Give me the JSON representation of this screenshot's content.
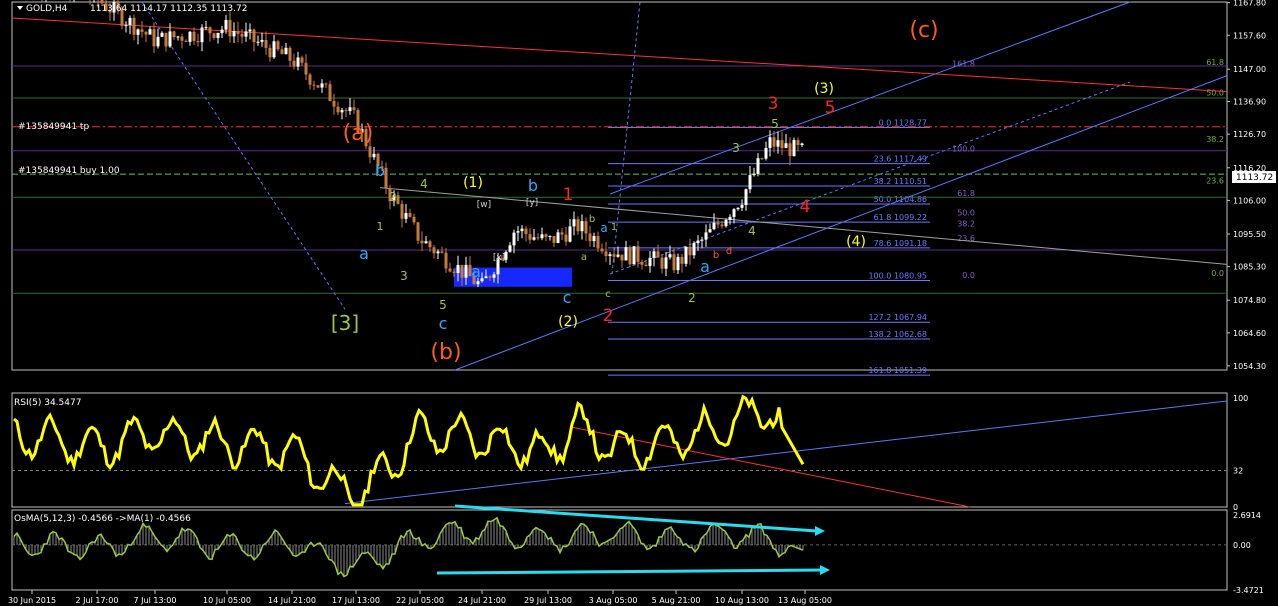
{
  "colors": {
    "background": "#000000",
    "frame": "#c0c0c0",
    "candle_up": "#ffffff",
    "candle_down": "#c87a3a",
    "rsi_line": "#ffff00",
    "osma_line": "#9ac840",
    "osma_hist": "#8a8a8a",
    "fib_blue": "#6a78ff",
    "channel": "#5a78ff",
    "trend_red": "#ff3030",
    "arrow_cyan": "#28dcf0",
    "zone_blue": "#1428ff",
    "hline_green": "#2e6a2e",
    "hline_purple": "#5a2a8a",
    "label_red": "#ff2020",
    "label_orange": "#ff5a1a",
    "label_yellow": "#ffff20",
    "label_green": "#9ac840",
    "label_cyan": "#30a8ff"
  },
  "header": {
    "title": "GOLD,H4",
    "ohlc": "1113.64 1114.17 1112.35 1113.72"
  },
  "order_lines": {
    "tp_label": "#135849941 tp",
    "buy_label": "#135849941 buy 1.00",
    "current_price": "1113.72"
  },
  "chart_data": [
    {
      "type": "line",
      "panel": "price",
      "symbol": "GOLD",
      "timeframe": "H4",
      "title": "GOLD,H4 1113.64 1114.17 1112.35 1113.72",
      "ylim": [
        1053,
        1168
      ],
      "price_axis": [
        "1167.80",
        "1157.60",
        "1147.00",
        "1136.90",
        "1126.70",
        "1116.20",
        "1106.00",
        "1095.50",
        "1085.30",
        "1074.80",
        "1064.60",
        "1054.30"
      ],
      "x_labels": [
        "30 Jun 2015",
        "2 Jul 17:00",
        "7 Jul 13:00",
        "10 Jul 05:00",
        "14 Jul 21:00",
        "17 Jul 13:00",
        "22 Jul 05:00",
        "24 Jul 21:00",
        "29 Jul 13:00",
        "3 Aug 05:00",
        "5 Aug 21:00",
        "10 Aug 13:00",
        "13 Aug 05:00"
      ],
      "series": [
        {
          "name": "GOLD",
          "x": [
            "30 Jun 2015",
            "2 Jul 17:00",
            "7 Jul 13:00",
            "10 Jul 05:00",
            "14 Jul 21:00",
            "17 Jul 13:00",
            "20 Jul 05:00",
            "22 Jul 05:00",
            "24 Jul 21:00",
            "27 Jul 21:00",
            "29 Jul 13:00",
            "31 Jul 09:00",
            "3 Aug 05:00",
            "5 Aug 21:00",
            "7 Aug 13:00",
            "10 Aug 13:00",
            "11 Aug 21:00",
            "13 Aug 05:00",
            "14 Aug 05:00"
          ],
          "values": [
            1174.5,
            1169.0,
            1156.0,
            1160.0,
            1150.0,
            1131.0,
            1108.0,
            1094.0,
            1079.0,
            1097.0,
            1093.0,
            1098.0,
            1090.0,
            1086.0,
            1094.5,
            1107.0,
            1124.0,
            1121.0,
            1113.7
          ]
        }
      ],
      "fibonacci": {
        "retracement": [
          {
            "label": "0.0 1128.77",
            "value": 1128.77
          },
          {
            "label": "23.6 1117.49",
            "value": 1117.49
          },
          {
            "label": "38.2 1110.51",
            "value": 1110.51
          },
          {
            "label": "50.0 1104.86",
            "value": 1104.86
          },
          {
            "label": "61.8 1099.22",
            "value": 1099.22
          },
          {
            "label": "78.6 1091.18",
            "value": 1091.18
          },
          {
            "label": "100.0 1080.95",
            "value": 1080.95
          },
          {
            "label": "127.2 1067.94",
            "value": 1067.94
          },
          {
            "label": "138.2 1062.68",
            "value": 1062.68
          },
          {
            "label": "161.8 1051.39",
            "value": 1051.39
          }
        ],
        "purple_levels": [
          "161.8",
          "100.0",
          "61.8",
          "50.0",
          "38.2",
          "23.6",
          "0.0"
        ],
        "green_levels": [
          "61.8",
          "50.0",
          "38.2",
          "23.6",
          "0.0"
        ]
      },
      "wave_labels": {
        "red": [
          "3",
          "5",
          "1",
          "4",
          "2"
        ],
        "orange": [
          "(c)",
          "(a)",
          "(b)"
        ],
        "yellow": [
          "(3)",
          "(1)",
          "(4)",
          "(2)"
        ],
        "green": [
          "[3]",
          "4",
          "2",
          "3",
          "5",
          "1",
          "3",
          "4",
          "5",
          "2",
          "a",
          "b",
          "c",
          "1"
        ],
        "cyan": [
          "b",
          "a",
          "b",
          "c",
          "c",
          "a",
          "a",
          "a"
        ],
        "white": [
          "[w]",
          "[y]",
          "[x]"
        ]
      }
    },
    {
      "type": "line",
      "panel": "rsi",
      "title": "RSI(5) 34.5477",
      "ylim": [
        0,
        100
      ],
      "levels": [
        "100",
        "32",
        "0"
      ],
      "series": [
        {
          "name": "RSI(5)",
          "x": [
            "30 Jun 2015",
            "2 Jul 17:00",
            "7 Jul 13:00",
            "10 Jul 05:00",
            "14 Jul 21:00",
            "17 Jul 13:00",
            "22 Jul 05:00",
            "24 Jul 21:00",
            "29 Jul 13:00",
            "31 Jul 09:00",
            "3 Aug 05:00",
            "5 Aug 21:00",
            "10 Aug 13:00",
            "12 Aug 13:00",
            "13 Aug 05:00"
          ],
          "values": [
            62,
            52,
            64,
            56,
            48,
            6,
            66,
            60,
            48,
            72,
            50,
            58,
            76,
            88,
            34.5
          ]
        }
      ]
    },
    {
      "type": "line",
      "panel": "osma",
      "title": "OsMA(5,12,3) -0.4566 ->MA(1) -0.4566",
      "ylim": [
        -3.4721,
        2.6914
      ],
      "levels": [
        "2.6914",
        "0.00",
        "-3.4721"
      ],
      "series": [
        {
          "name": "OsMA(5,12,3)",
          "x": [
            "30 Jun 2015",
            "2 Jul 17:00",
            "7 Jul 13:00",
            "10 Jul 05:00",
            "14 Jul 21:00",
            "17 Jul 13:00",
            "22 Jul 05:00",
            "24 Jul 21:00",
            "29 Jul 13:00",
            "3 Aug 05:00",
            "5 Aug 21:00",
            "10 Aug 13:00",
            "13 Aug 05:00"
          ],
          "values": [
            0.1,
            -0.5,
            1.2,
            -0.4,
            0.2,
            -3.0,
            0.9,
            2.1,
            0.8,
            1.5,
            0.6,
            1.4,
            -0.46
          ]
        }
      ]
    }
  ]
}
